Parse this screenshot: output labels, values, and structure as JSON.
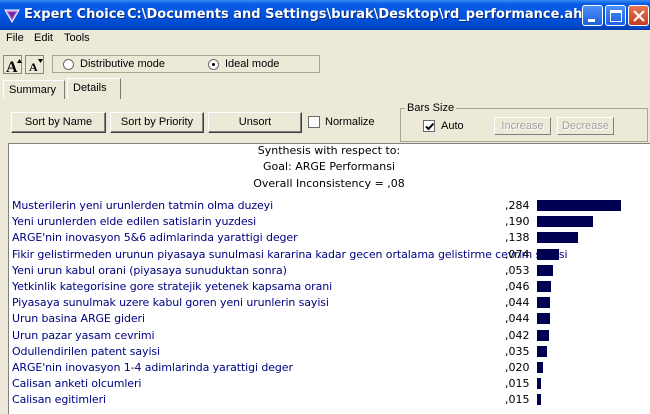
{
  "window": {
    "app_name": "Expert Choice",
    "file_path": "C:\\Documents and Settings\\burak\\Desktop\\rd_performance.ahp"
  },
  "menu": [
    "File",
    "Edit",
    "Tools"
  ],
  "toolbar": {
    "mode_options": [
      {
        "label": "Distributive mode",
        "selected": false
      },
      {
        "label": "Ideal mode",
        "selected": true
      }
    ]
  },
  "tabs": [
    {
      "label": "Summary",
      "active": false
    },
    {
      "label": "Details",
      "active": true
    }
  ],
  "controls": {
    "sort_by_name": "Sort by Name",
    "sort_by_priority": "Sort by Priority",
    "unsort": "Unsort",
    "normalize": "Normalize",
    "normalize_checked": false,
    "bars_size_label": "Bars Size",
    "auto_label": "Auto",
    "auto_checked": true,
    "increase": "Increase",
    "decrease": "Decrease"
  },
  "synthesis": {
    "heading": "Synthesis with respect to:",
    "goal": "Goal: ARGE Performansi",
    "inconsistency": "Overall Inconsistency = ,08"
  },
  "bar_color": "#000050",
  "chart_data": {
    "type": "bar",
    "orientation": "horizontal",
    "categories": [
      "Musterilerin yeni urunlerden tatmin olma duzeyi",
      "Yeni urunlerden elde edilen satislarin yuzdesi",
      "ARGE'nin inovasyon 5&6 adimlarinda yarattigi deger",
      "Fikir gelistirmeden urunun piyasaya sunulmasi kararina kadar gecen ortalama gelistirme cevrim suresi",
      "Yeni urun kabul orani (piyasaya sunuduktan sonra)",
      "Yetkinlik kategorisine gore stratejik yetenek kapsama orani",
      "Piyasaya sunulmak uzere kabul goren yeni urunlerin sayisi",
      "Urun basina ARGE gideri",
      "Urun pazar yasam cevrimi",
      "Odullendirilen patent sayisi",
      "ARGE'nin inovasyon 1-4 adimlarinda yarattigi deger",
      "Calisan anketi olcumleri",
      "Calisan egitimleri"
    ],
    "value_labels": [
      ",284",
      ",190",
      ",138",
      ",074",
      ",053",
      ",046",
      ",044",
      ",044",
      ",042",
      ",035",
      ",020",
      ",015",
      ",015"
    ],
    "values": [
      0.284,
      0.19,
      0.138,
      0.074,
      0.053,
      0.046,
      0.044,
      0.044,
      0.042,
      0.035,
      0.02,
      0.015,
      0.015
    ]
  }
}
